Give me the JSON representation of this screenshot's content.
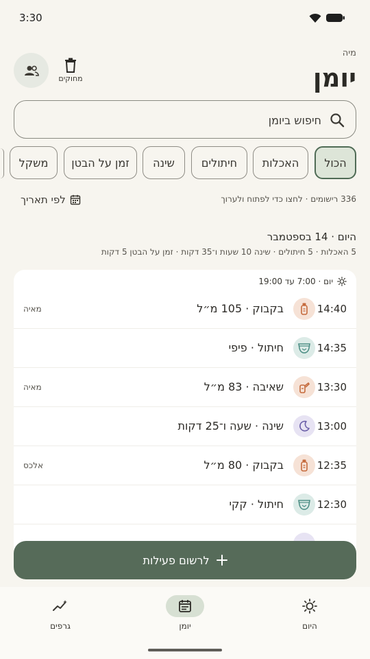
{
  "status_bar": {
    "time": "3:30"
  },
  "header": {
    "child_name": "מיה",
    "title": "יומן",
    "delete_label": "מחוקים"
  },
  "search": {
    "placeholder": "חיפוש ביומן"
  },
  "filters": [
    {
      "label": "הכול",
      "active": true
    },
    {
      "label": "האכלות",
      "active": false
    },
    {
      "label": "חיתולים",
      "active": false
    },
    {
      "label": "שינה",
      "active": false
    },
    {
      "label": "זמן על הבטן",
      "active": false
    },
    {
      "label": "משקל",
      "active": false
    }
  ],
  "list_info": {
    "count_text": "336 רישומים · לחצו כדי לפתוח ולערוך",
    "by_date_label": "לפי תאריך"
  },
  "day": {
    "title": "היום · 14 בספטמבר",
    "summary": "5 האכלות · 5 חיתולים · שינה 10 שעות ו־35 דקות · זמן על הבטן 5 דקות"
  },
  "period": {
    "label": "יום · 7:00 עד 19:00",
    "icon": "sun-icon"
  },
  "entries": [
    {
      "time": "14:40",
      "icon": "bottle-icon",
      "text": "בקבוק · 105 מ״ל",
      "caregiver": "מאיה",
      "icon_bg": "#f6e2d6",
      "icon_color": "#c56a3c"
    },
    {
      "time": "14:35",
      "icon": "diaper-icon",
      "text": "חיתול · פיפי",
      "caregiver": "",
      "icon_bg": "#dcebe7",
      "icon_color": "#4e8f86"
    },
    {
      "time": "13:30",
      "icon": "pump-icon",
      "text": "שאיבה · 83 מ״ל",
      "caregiver": "מאיה",
      "icon_bg": "#f6e2d6",
      "icon_color": "#c56a3c"
    },
    {
      "time": "13:00",
      "icon": "moon-icon",
      "text": "שינה · שעה ו־25 דקות",
      "caregiver": "",
      "icon_bg": "#e7e3f3",
      "icon_color": "#6b5fa8"
    },
    {
      "time": "12:35",
      "icon": "bottle-icon",
      "text": "בקבוק · 80 מ״ל",
      "caregiver": "אלכס",
      "icon_bg": "#f6e2d6",
      "icon_color": "#c56a3c"
    },
    {
      "time": "12:30",
      "icon": "diaper-icon",
      "text": "חיתול · קקי",
      "caregiver": "",
      "icon_bg": "#dcebe7",
      "icon_color": "#4e8f86"
    }
  ],
  "fab": {
    "label": "לרשום פעילות"
  },
  "nav": [
    {
      "label": "גרפים",
      "icon": "chart-icon",
      "active": false
    },
    {
      "label": "יומן",
      "icon": "journal-icon",
      "active": true
    },
    {
      "label": "היום",
      "icon": "sun-icon",
      "active": false
    }
  ],
  "colors": {
    "accent": "#566b59",
    "chip_active_bg": "#dde5d8",
    "background": "#f7f5ef"
  }
}
